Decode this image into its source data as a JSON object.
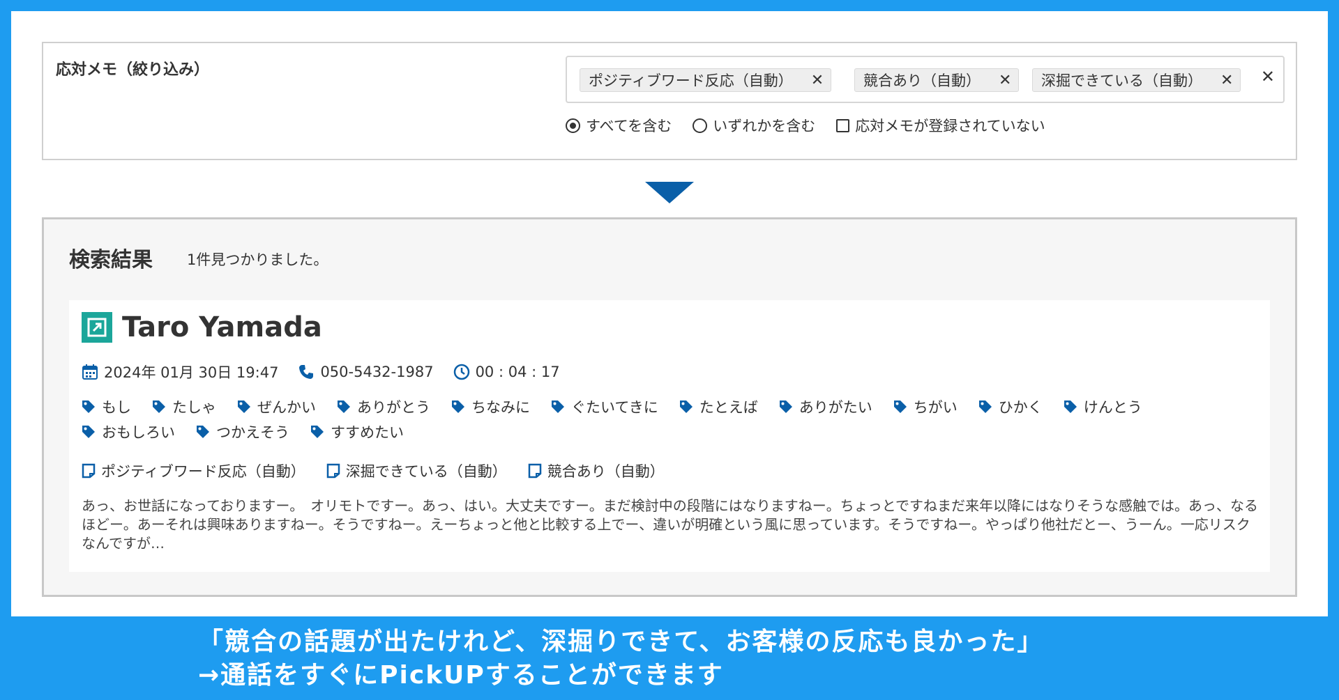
{
  "filter": {
    "title": "応対メモ（絞り込み）",
    "chips": [
      {
        "label": "ポジティブワード反応（自動）"
      },
      {
        "label": "競合あり（自動）"
      },
      {
        "label": "深掘できている（自動）"
      }
    ],
    "remove_glyph": "✕",
    "clear_glyph": "✕",
    "options": [
      {
        "label": "すべてを含む",
        "selected": true
      },
      {
        "label": "いずれかを含む",
        "selected": false
      },
      {
        "label": "応対メモが登録されていない",
        "selected": false
      }
    ]
  },
  "results": {
    "heading": "検索結果",
    "count_text": "1件見つかりました。",
    "item": {
      "name": "Taro Yamada",
      "datetime": "2024年 01月 30日 19:47",
      "phone": "050-5432-1987",
      "duration": "00 : 04 : 17",
      "keywords": [
        "もし",
        "たしゃ",
        "ぜんかい",
        "ありがとう",
        "ちなみに",
        "ぐたいてきに",
        "たとえば",
        "ありがたい",
        "ちがい",
        "ひかく",
        "けんとう",
        "おもしろい",
        "つかえそう",
        "すすめたい"
      ],
      "memos": [
        "ポジティブワード反応（自動）",
        "深掘できている（自動）",
        "競合あり（自動）"
      ],
      "transcript": "あっ、お世話になっておりますー。　オリモトですー。あっ、はい。大丈夫ですー。まだ検討中の段階にはなりますねー。ちょっとですねまだ来年以降にはなりそうな感触では。あっ、なるほどー。あーそれは興味ありますねー。そうですねー。えーちょっと他と比較する上でー、違いが明確という風に思っています。そうですねー。やっぱり他社だとー、うーん。一応リスクなんですが…"
    }
  },
  "caption": {
    "line1": "「競合の話題が出たけれど、深掘りできて、お客様の反応も良かった」",
    "line2": "→通話をすぐにPickUPすることができます"
  },
  "colors": {
    "background": "#1e9cf0",
    "accent": "#0a5fa8",
    "open_icon": "#1ba69a"
  }
}
